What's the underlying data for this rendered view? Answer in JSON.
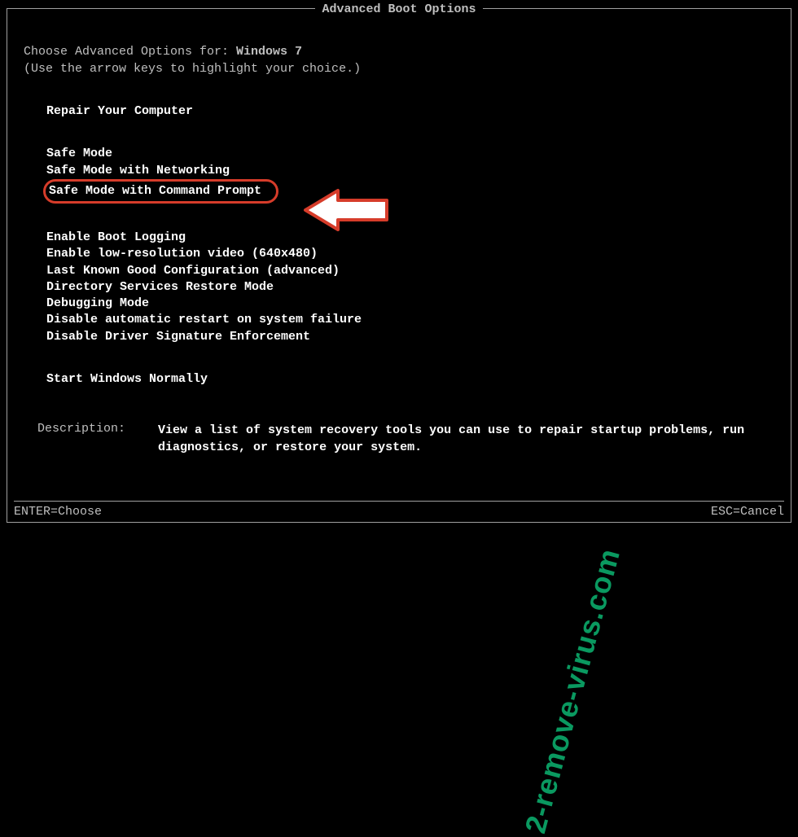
{
  "title": "Advanced Boot Options",
  "intro": {
    "prefix": "Choose Advanced Options for: ",
    "os": "Windows 7",
    "hint": "(Use the arrow keys to highlight your choice.)"
  },
  "groups": [
    {
      "items": [
        {
          "label": "Repair Your Computer",
          "highlighted": false
        }
      ]
    },
    {
      "items": [
        {
          "label": "Safe Mode",
          "highlighted": false
        },
        {
          "label": "Safe Mode with Networking",
          "highlighted": false
        },
        {
          "label": "Safe Mode with Command Prompt",
          "highlighted": true
        }
      ]
    },
    {
      "items": [
        {
          "label": "Enable Boot Logging",
          "highlighted": false
        },
        {
          "label": "Enable low-resolution video (640x480)",
          "highlighted": false
        },
        {
          "label": "Last Known Good Configuration (advanced)",
          "highlighted": false
        },
        {
          "label": "Directory Services Restore Mode",
          "highlighted": false
        },
        {
          "label": "Debugging Mode",
          "highlighted": false
        },
        {
          "label": "Disable automatic restart on system failure",
          "highlighted": false
        },
        {
          "label": "Disable Driver Signature Enforcement",
          "highlighted": false
        }
      ]
    },
    {
      "items": [
        {
          "label": "Start Windows Normally",
          "highlighted": false
        }
      ]
    }
  ],
  "description": {
    "label": "Description:",
    "text": "View a list of system recovery tools you can use to repair startup problems, run diagnostics, or restore your system."
  },
  "footer": {
    "left": "ENTER=Choose",
    "right": "ESC=Cancel"
  },
  "watermark": "2-remove-virus.com"
}
